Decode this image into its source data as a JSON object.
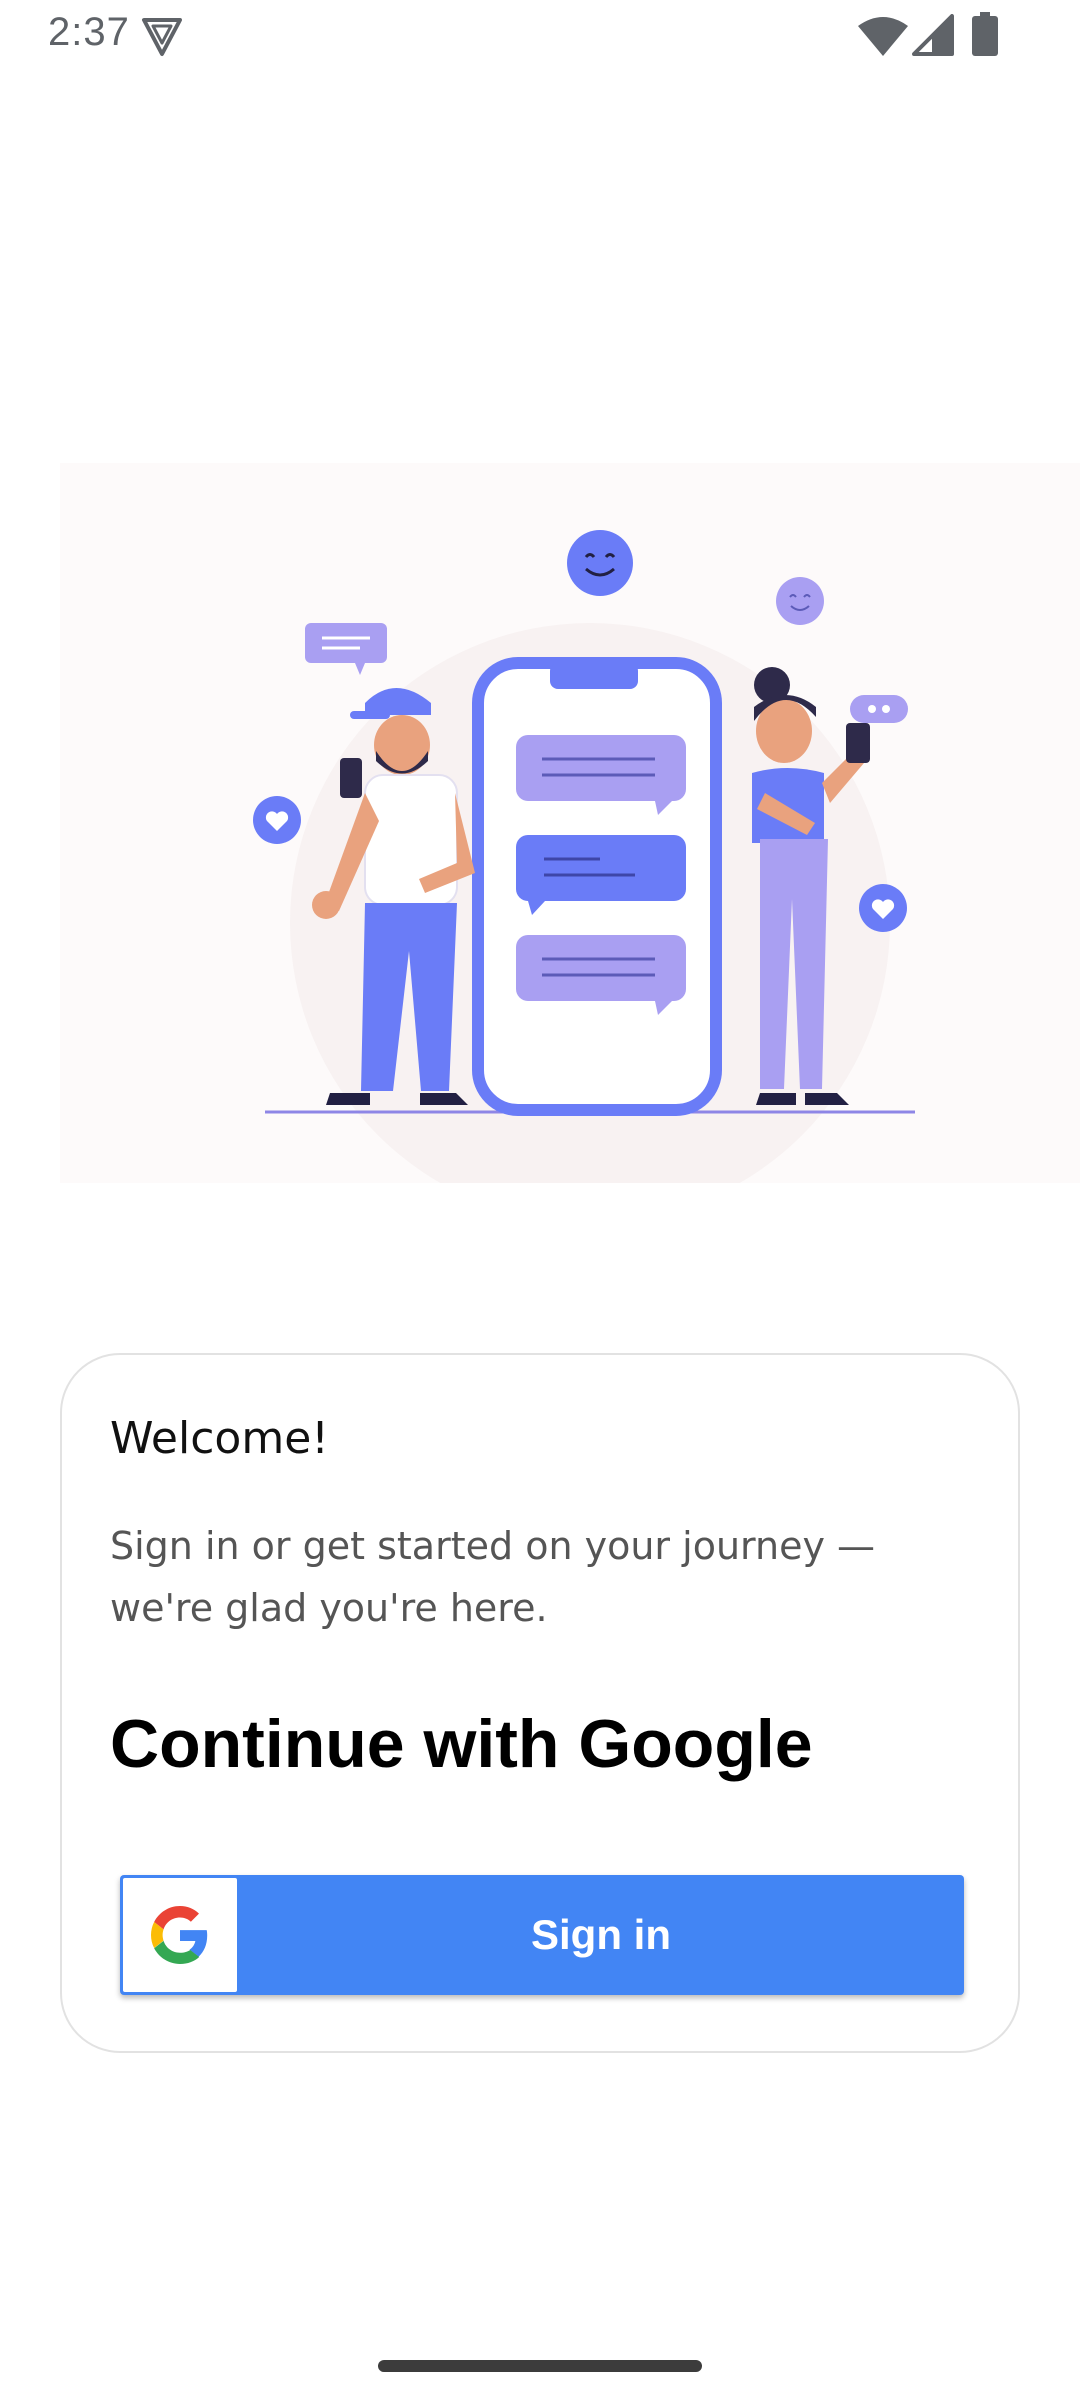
{
  "status_bar": {
    "time": "2:37",
    "icons": [
      "vpn-icon",
      "wifi-icon",
      "cell-signal-icon",
      "battery-icon"
    ]
  },
  "illustration": {
    "description_icon": "people-chatting-illustration",
    "colors": {
      "primary": "#6a7cf7",
      "light": "#a99ff2",
      "skin": "#e9a27e",
      "dark": "#222043"
    }
  },
  "card": {
    "welcome": "Welcome!",
    "subtitle": "Sign in or get started on your journey — we're glad you're here.",
    "heading": "Continue with Google",
    "signin_button": {
      "label": "Sign in",
      "icon": "google-g-icon",
      "color": "#4285f4"
    }
  }
}
